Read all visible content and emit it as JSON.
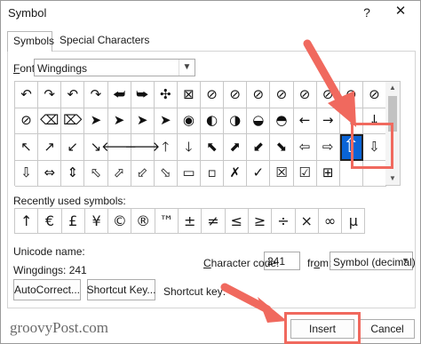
{
  "dialog": {
    "title": "Symbol",
    "help_glyph": "?",
    "close_glyph": "✕"
  },
  "tabs": [
    {
      "label": "Symbols",
      "active": true
    },
    {
      "label": "Special Characters",
      "active": false
    }
  ],
  "font": {
    "label_prefix": "F",
    "label_rest": "ont:",
    "value": "Wingdings"
  },
  "symbol_grid": [
    "↶",
    "↷",
    "↶",
    "↷",
    "⮨",
    "⮩",
    "✣",
    "⊠",
    "⊘",
    "⊘",
    "⊘",
    "⊘",
    "⊘",
    "⊘",
    "⊘",
    "⊘",
    "⊘",
    "⌫",
    "⌦",
    "➤",
    "➤",
    "➤",
    "➤",
    "◉",
    "◐",
    "◑",
    "◒",
    "◓",
    "←",
    "→",
    "↑",
    "↓",
    "↖",
    "↗",
    "↙",
    "↘",
    "🡐",
    "🡒",
    "🡑",
    "🡓",
    "⬉",
    "⬈",
    "⬋",
    "⬊",
    "⇦",
    "⇨",
    "⇧",
    "⇩",
    "⇩",
    "⇔",
    "⇕",
    "⬁",
    "⬀",
    "⬃",
    "⬂",
    "▭",
    "▫",
    "✗",
    "✓",
    "☒",
    "☑",
    "⊞",
    "",
    ""
  ],
  "selected_index": 46,
  "recent": {
    "label": "Recently used symbols:",
    "symbols": [
      "↑",
      "€",
      "£",
      "¥",
      "©",
      "®",
      "™",
      "±",
      "≠",
      "≤",
      "≥",
      "÷",
      "×",
      "∞",
      "µ"
    ]
  },
  "unicode_name_label": "Unicode name:",
  "character_name": "Wingdings: 241",
  "character_code": {
    "label_prefix": "C",
    "label_rest": "haracter code:",
    "value": "241"
  },
  "from": {
    "label_prefix": "fr",
    "label_u": "o",
    "label_rest": "m:",
    "value": "Symbol (decimal)"
  },
  "buttons": {
    "autocorrect": "AutoCorrect...",
    "shortcut_key": "Shortcut Key...",
    "insert": "Insert",
    "cancel": "Cancel"
  },
  "shortcut_key_label": "Shortcut key:",
  "watermark": "groovyPost.com",
  "colors": {
    "accent": "#0a64d6",
    "highlight": "#f0695e"
  }
}
